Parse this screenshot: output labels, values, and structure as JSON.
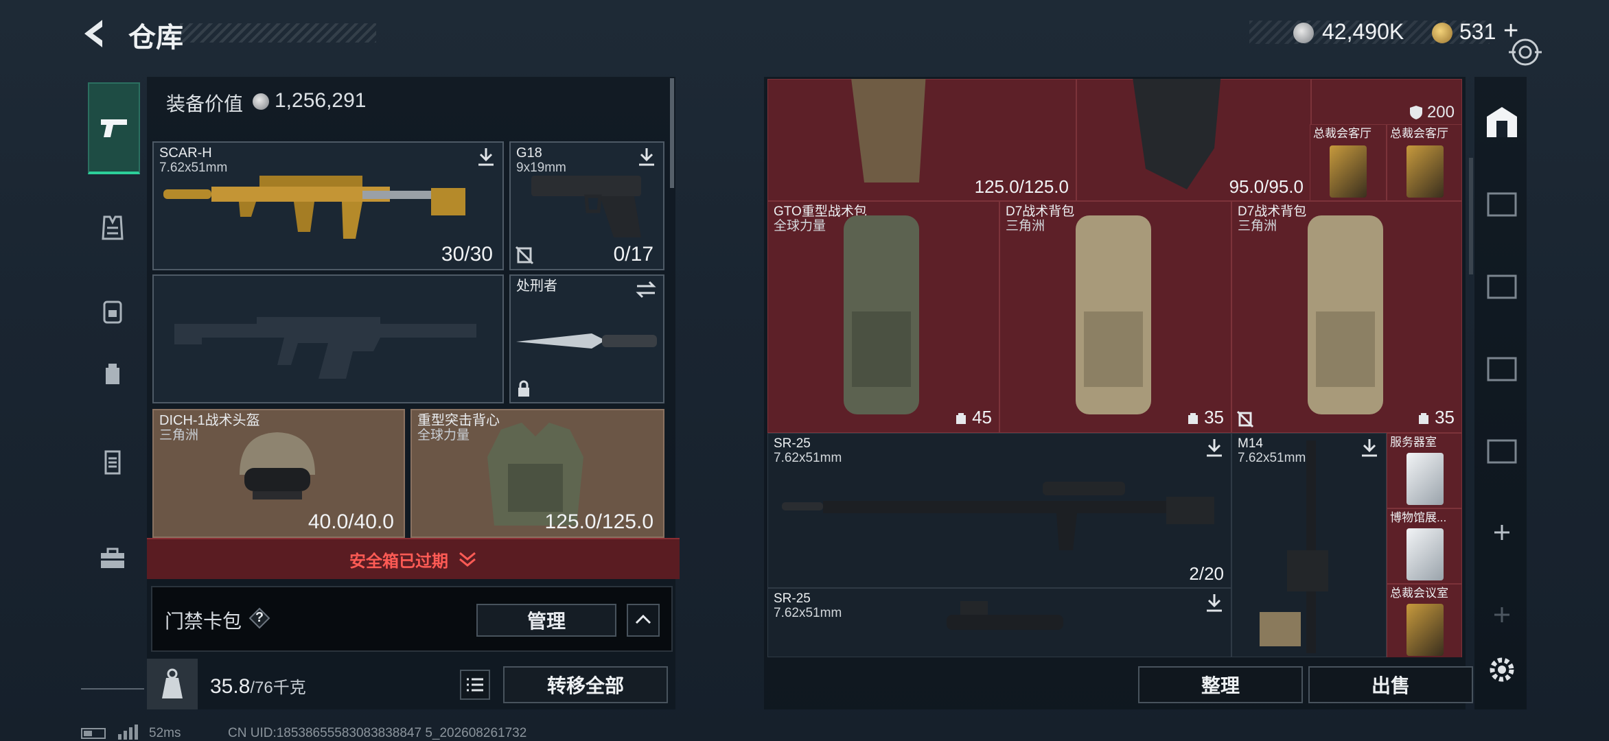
{
  "header": {
    "title": "仓库",
    "silver_amount": "42,490K",
    "gold_amount": "531",
    "add_label": "+"
  },
  "left_nav": {
    "items": [
      "pistol-icon",
      "armor-icon",
      "backpack-chest-icon",
      "backpack-icon",
      "keycard-icon",
      "briefcase-icon"
    ]
  },
  "equipment": {
    "value_label": "装备价值",
    "value": "1,256,291",
    "slots": {
      "primary": {
        "name": "SCAR-H",
        "caliber": "7.62x51mm",
        "ammo": "30/30"
      },
      "pistol": {
        "name": "G18",
        "caliber": "9x19mm",
        "ammo": "0/17"
      },
      "melee": {
        "name": "处刑者"
      },
      "helmet": {
        "name": "DICH-1战术头盔",
        "region": "三角洲",
        "durability": "40.0/40.0"
      },
      "vest": {
        "name": "重型突击背心",
        "region": "全球力量",
        "durability": "125.0/125.0"
      }
    },
    "safe_box_expired": "安全箱已过期",
    "keycard_label": "门禁卡包",
    "help_label": "?",
    "manage_label": "管理",
    "weight": "35.8",
    "weight_max": "/76千克",
    "transfer_all_label": "转移全部"
  },
  "storage": {
    "top_row": {
      "item1_durability": "125.0/125.0",
      "item2_durability": "95.0/95.0",
      "armor_value": "200",
      "card1": "总裁会客厅",
      "card2": "总裁会客厅"
    },
    "backpacks": [
      {
        "name": "GTO重型战术包",
        "region": "全球力量",
        "capacity": "45"
      },
      {
        "name": "D7战术背包",
        "region": "三角洲",
        "capacity": "35"
      },
      {
        "name": "D7战术背包",
        "region": "三角洲",
        "capacity": "35"
      }
    ],
    "guns": [
      {
        "name": "SR-25",
        "caliber": "7.62x51mm",
        "ammo": "2/20"
      },
      {
        "name": "M14",
        "caliber": "7.62x51mm"
      },
      {
        "name": "SR-25",
        "caliber": "7.62x51mm"
      }
    ],
    "cards": [
      "服务器室",
      "博物馆展...",
      "总裁会议室"
    ],
    "organize_label": "整理",
    "sell_label": "出售"
  },
  "status": {
    "ping": "52ms",
    "uid": "CN UID:18538655583083838847 5_202608261732"
  },
  "colors": {
    "accent_green": "#2ccf9a",
    "expired_red": "#ff5b55",
    "storage_red": "#5d2028"
  }
}
